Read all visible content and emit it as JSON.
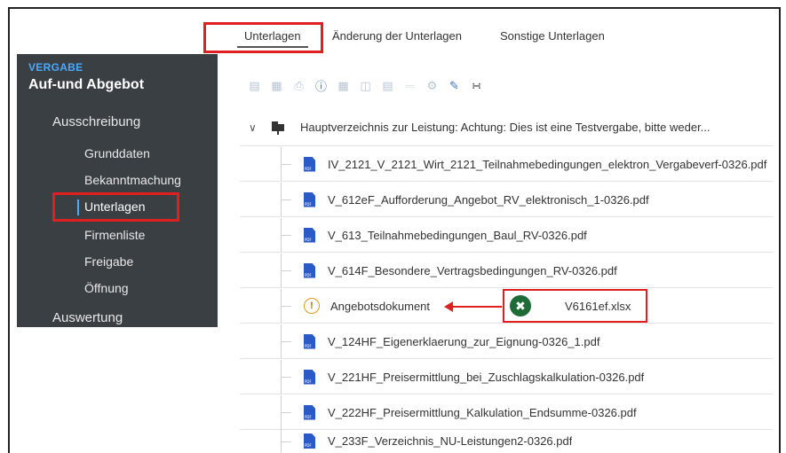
{
  "tabs": [
    {
      "label": "Unterlagen",
      "active": true
    },
    {
      "label": "Änderung der Unterlagen",
      "active": false
    },
    {
      "label": "Sonstige Unterlagen",
      "active": false
    }
  ],
  "sidebar": {
    "section": "VERGABE",
    "title": "Auf-und Abgebot",
    "group": "Ausschreibung",
    "items": [
      {
        "label": "Grunddaten"
      },
      {
        "label": "Bekanntmachung"
      },
      {
        "label": "Unterlagen",
        "active": true
      },
      {
        "label": "Firmenliste"
      },
      {
        "label": "Freigabe"
      },
      {
        "label": "Öffnung"
      }
    ],
    "evaluation": "Auswertung"
  },
  "tree": {
    "root_label": "Hauptverzeichnis zur Leistung: Achtung: Dies ist eine Testvergabe, bitte weder...",
    "files": [
      "IV_2121_V_2121_Wirt_2121_Teilnahmebedingungen_elektron_Vergabeverf-0326.pdf",
      "V_612eF_Aufforderung_Angebot_RV_elektronisch_1-0326.pdf",
      "V_613_Teilnahmebedingungen_Baul_RV-0326.pdf",
      "V_614F_Besondere_Vertragsbedingungen_RV-0326.pdf",
      "Angebotsdokument",
      "V_124HF_Eigenerklaerung_zur_Eignung-0326_1.pdf",
      "V_221HF_Preisermittlung_bei_Zuschlagskalkulation-0326.pdf",
      "V_222HF_Preisermittlung_Kalkulation_Endsumme-0326.pdf",
      "V_233F_Verzeichnis_NU-Leistungen2-0326.pdf"
    ],
    "pdf_badge": "PDF"
  },
  "callout": {
    "file": "V6161ef.xlsx",
    "icon": "excel-icon"
  },
  "colors": {
    "highlight": "#e02020",
    "sidebar_bg": "#3a3f44",
    "accent": "#4aa8ff",
    "pdf": "#2a5ac8"
  }
}
